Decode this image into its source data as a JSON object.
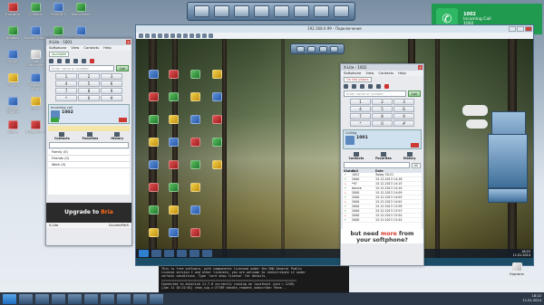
{
  "desktop": {
    "left_icons": [
      {
        "label": "Корзина"
      },
      {
        "label": "Dropbox"
      },
      {
        "label": "Skype"
      },
      {
        "label": "uTorrent"
      },
      {
        "label": "Google Chrome"
      },
      {
        "label": "Opera"
      },
      {
        "label": "CCleaner"
      },
      {
        "label": "Mozilla Firefox"
      },
      {
        "label": "Total Commander"
      },
      {
        "label": "Microsoft Word"
      },
      {
        "label": "Excel"
      },
      {
        "label": "Notepad++"
      },
      {
        "label": "Paint.NET"
      },
      {
        "label": "Photoshop"
      },
      {
        "label": "VLC"
      },
      {
        "label": "Picasa"
      },
      {
        "label": "Steam"
      },
      {
        "label": "WinRAR"
      },
      {
        "label": "Teamviewer"
      },
      {
        "label": "FileZilla"
      },
      {
        "label": "AIMP3"
      },
      {
        "label": "Daemon Tools"
      },
      {
        "label": "X-Lite"
      }
    ],
    "right_icons": [
      {
        "label": "Корзина"
      }
    ]
  },
  "notification": {
    "title": "1002",
    "subtitle": "Incoming Call",
    "number": "1002"
  },
  "xlite_outer": {
    "title": "X-Lite - 1001",
    "menu": [
      "Softphone",
      "View",
      "Contacts",
      "Help"
    ],
    "availability": "Available",
    "dial_placeholder": "Enter name or number",
    "call_button": "Call",
    "keypad": [
      "1",
      "2",
      "3",
      "4",
      "5",
      "6",
      "7",
      "8",
      "9",
      "*",
      "0",
      "#"
    ],
    "call": {
      "label": "Incoming call",
      "number": "1002"
    },
    "tabs": [
      "Contacts",
      "Favorites",
      "History"
    ],
    "groups": [
      "Family (0)",
      "Friends (0)",
      "Work (0)"
    ],
    "promo_text": "Upgrade to",
    "promo_brand": "Bria",
    "footer_left": "X-Lite",
    "footer_right": "CounterPath"
  },
  "vm": {
    "title": "192.168.0.99 - Подключение",
    "clock_time": "18:22",
    "clock_date": "11.01.2014"
  },
  "xlite_inner": {
    "title": "X-Lite - 1002",
    "menu": [
      "Softphone",
      "View",
      "Contacts",
      "Help"
    ],
    "availability": "On the phone",
    "dial_placeholder": "Enter name or number",
    "call_button": "Call",
    "keypad": [
      "1",
      "2",
      "3",
      "4",
      "5",
      "6",
      "7",
      "8",
      "9",
      "*",
      "0",
      "#"
    ],
    "call": {
      "label": "Calling",
      "number": "1001"
    },
    "tabs": [
      "Contacts",
      "Favorites",
      "History"
    ],
    "filter": "All",
    "list_headers": [
      "Status",
      "Call",
      "Date"
    ],
    "history": [
      {
        "status": "↗",
        "call": "1001",
        "date": "Today 18:21"
      },
      {
        "status": "↗",
        "call": "2000",
        "date": "15.12.2013 14:16"
      },
      {
        "status": "↘",
        "call": "*97",
        "date": "15.12.2013 14:15"
      },
      {
        "status": "↗",
        "call": "device",
        "date": "15.12.2013 14:10"
      },
      {
        "status": "↘",
        "call": "2000",
        "date": "15.12.2013 14:09"
      },
      {
        "status": "↗",
        "call": "2000",
        "date": "15.12.2013 14:05"
      },
      {
        "status": "↘",
        "call": "2000",
        "date": "15.12.2013 14:02"
      },
      {
        "status": "↗",
        "call": "2000",
        "date": "15.12.2013 13:58"
      },
      {
        "status": "↗",
        "call": "2000",
        "date": "15.12.2013 13:53"
      },
      {
        "status": "↘",
        "call": "2000",
        "date": "15.12.2013 13:50"
      },
      {
        "status": "↗",
        "call": "2000",
        "date": "15.12.2013 13:44"
      }
    ],
    "ad_line1_a": "but need ",
    "ad_line1_b": "more",
    "ad_line1_c": " from",
    "ad_line2": "your softphone?"
  },
  "terminal": {
    "lines": [
      "This is free software, with components licensed under the GNU General Public",
      "License version 2 and other licenses; you are welcome to redistribute it under",
      "certain conditions. Type 'core show license' for details.",
      "=========================================================================",
      "Connected to Asterisk 11.7.0 currently running on localhost (pid = 1249)",
      "[Jan 11 18:22:01] chan_sip.c:27789 handle_request_subscribe: Rece..."
    ]
  },
  "taskbar": {
    "clock_time": "18:22",
    "clock_date": "11.01.2014"
  },
  "colors": {
    "notification_bg": "#1f9a4e",
    "end_call": "#cc3a32",
    "answer": "#3aa23a",
    "bria": "#ff6a1a"
  }
}
